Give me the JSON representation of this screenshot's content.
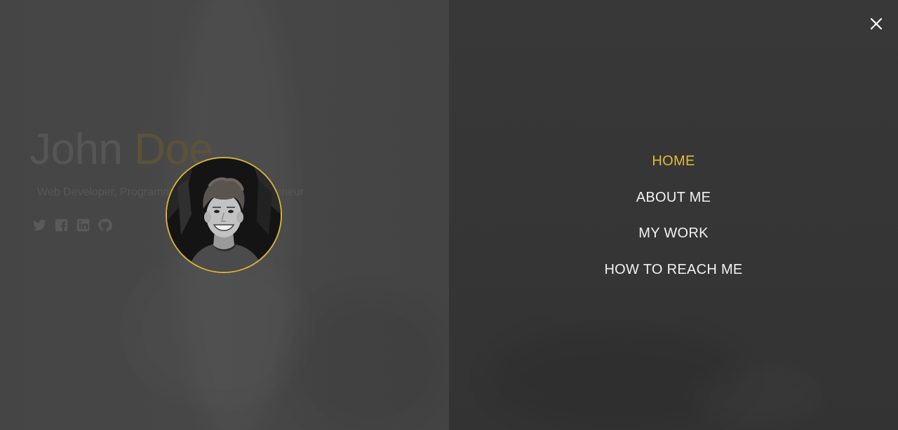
{
  "hero": {
    "first_name": "John",
    "last_name": "Doe",
    "subtitle": "Web Developer, Programmer, Designer, Entrepreneur"
  },
  "socials": [
    {
      "icon": "twitter-icon"
    },
    {
      "icon": "facebook-icon"
    },
    {
      "icon": "linkedin-icon"
    },
    {
      "icon": "github-icon"
    }
  ],
  "nav": {
    "items": [
      {
        "label": "HOME",
        "active": true
      },
      {
        "label": "ABOUT ME",
        "active": false
      },
      {
        "label": "MY WORK",
        "active": false
      },
      {
        "label": "HOW TO REACH ME",
        "active": false
      }
    ]
  },
  "colors": {
    "accent": "#e6b93b",
    "menu_text": "#f2f2f2",
    "overlay_left": "#454545",
    "overlay_right": "#363636"
  },
  "icons": {
    "close": "close-icon",
    "avatar": "avatar"
  }
}
